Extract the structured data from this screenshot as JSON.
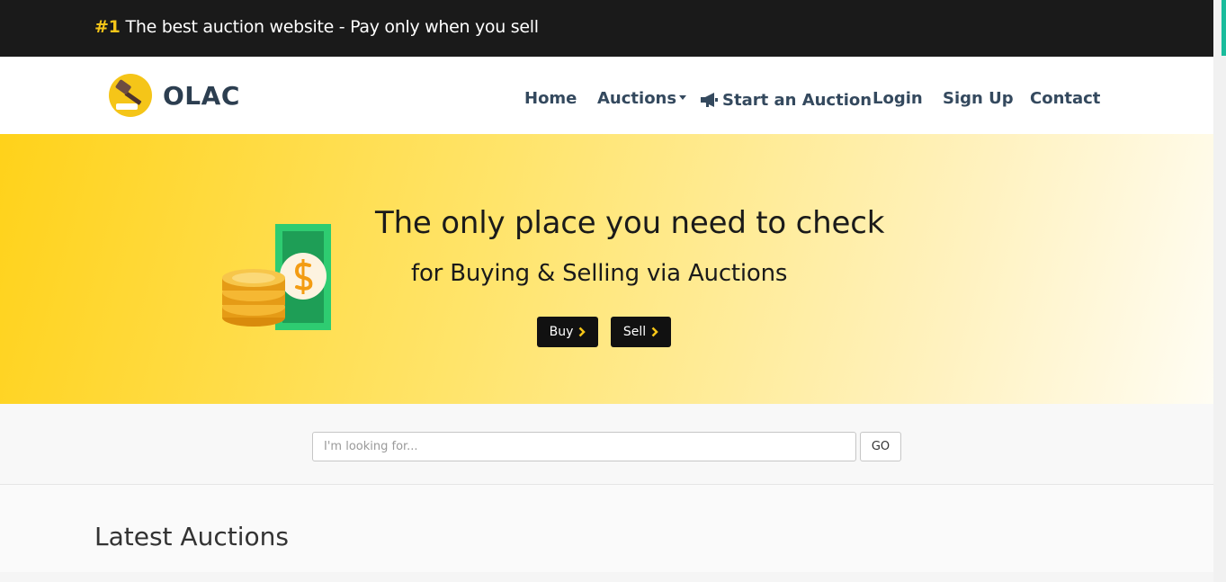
{
  "topbar": {
    "hash": "#1",
    "tagline": "The best auction website - Pay only when you sell"
  },
  "brand": {
    "name": "OLAC",
    "icon": "gavel-icon",
    "accent_color": "#f5c518"
  },
  "nav": {
    "home": "Home",
    "auctions": "Auctions",
    "start_auction": "Start an Auction",
    "login": "Login",
    "signup": "Sign Up",
    "contact": "Contact"
  },
  "hero": {
    "title": "The only place you need to check",
    "subtitle": "for Buying & Selling via Auctions",
    "buy_label": "Buy",
    "sell_label": "Sell",
    "illustration": "money-coins-icon"
  },
  "search": {
    "placeholder": "I'm looking for...",
    "go_label": "GO"
  },
  "latest": {
    "title": "Latest Auctions"
  }
}
